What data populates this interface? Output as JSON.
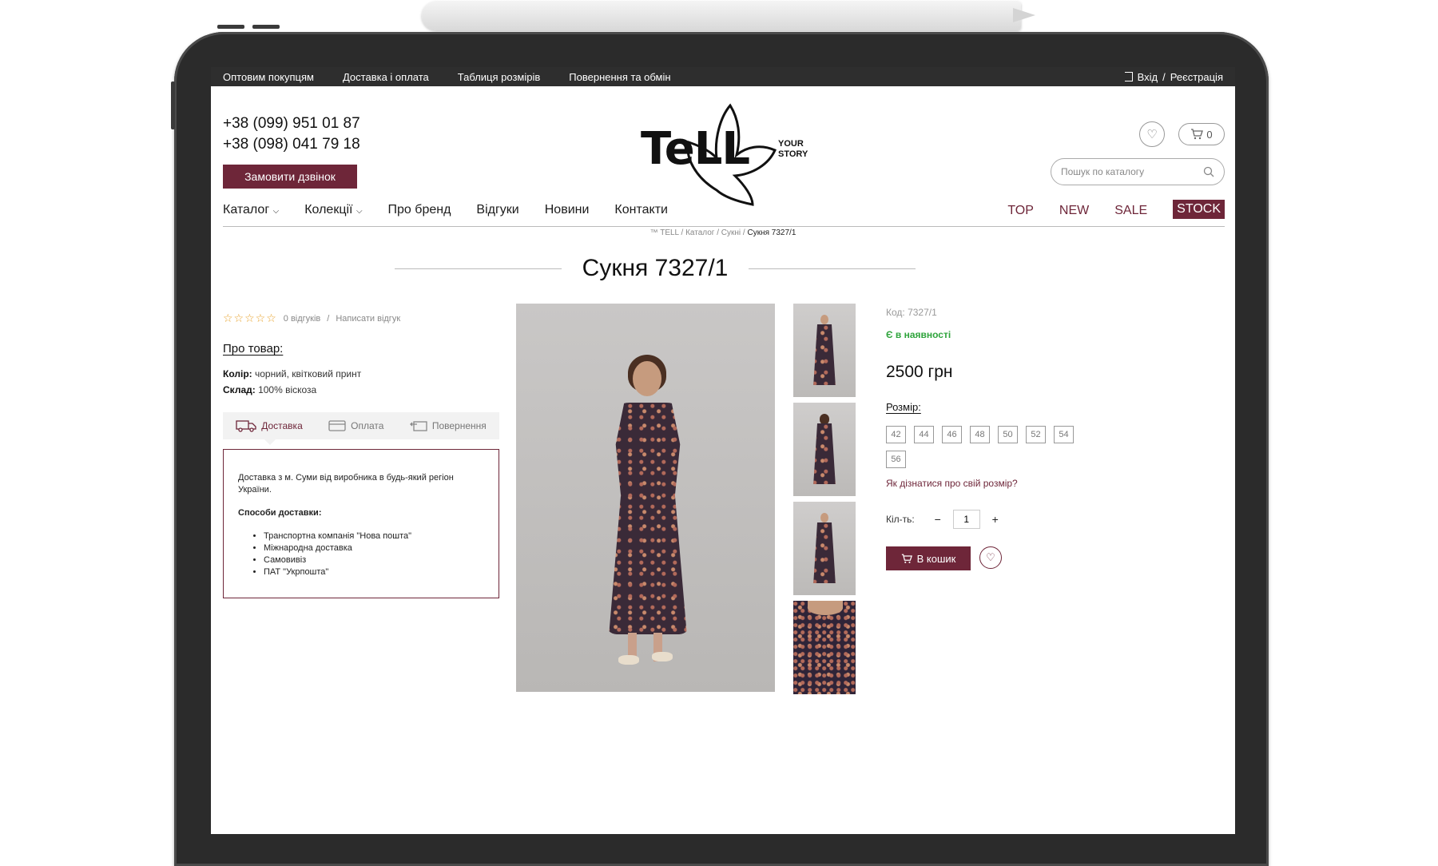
{
  "topbar": {
    "links": [
      "Оптовим покупцям",
      "Доставка і оплата",
      "Таблиця розмірів",
      "Повернення та обмін"
    ],
    "login": "Вхід",
    "separator": "/",
    "register": "Реєстрація"
  },
  "header": {
    "phones": [
      "+38 (099) 951 01 87",
      "+38 (098) 041 79 18"
    ],
    "callback_label": "Замовити дзвінок",
    "logo_text": "TeLL",
    "logo_tagline_1": "YOUR",
    "logo_tagline_2": "STORY",
    "cart_count": "0",
    "search_placeholder": "Пошук по каталогу"
  },
  "nav": {
    "catalog": "Каталог",
    "collections": "Колекції",
    "about": "Про бренд",
    "reviews": "Відгуки",
    "news": "Новини",
    "contacts": "Контакти",
    "tags": [
      "TOP",
      "NEW",
      "SALE"
    ],
    "stock": "STOCK"
  },
  "breadcrumb": {
    "items": [
      "™ TELL",
      "Каталог",
      "Сукні"
    ],
    "separator": "/",
    "current": "Сукня 7327/1"
  },
  "product": {
    "title": "Сукня 7327/1",
    "reviews_count": "0 відгуків",
    "reviews_separator": "/",
    "write_review": "Написати відгук",
    "about_title": "Про товар:",
    "color_label": "Колір:",
    "color_value": " чорний, квітковий принт",
    "composition_label": "Склад:",
    "composition_value": " 100% віскоза",
    "sku": "Код: 7327/1",
    "availability": "Є в наявності",
    "price": "2500 грн",
    "size_title": "Розмір:",
    "sizes": [
      "42",
      "44",
      "46",
      "48",
      "50",
      "52",
      "54",
      "56"
    ],
    "size_help": "Як дізнатися про свій розмір?",
    "qty_label": "Кіл-ть:",
    "qty_minus": "−",
    "qty_value": "1",
    "qty_plus": "+",
    "add_to_cart": "В кошик"
  },
  "info_tabs": {
    "tabs": [
      "Доставка",
      "Оплата",
      "Повернення"
    ],
    "active": 0,
    "delivery_text": "Доставка з м. Суми від виробника в будь-який регіон України.",
    "ways_title": "Способи доставки:",
    "ways": [
      "Транспортна компанія \"Нова пошта\"",
      "Міжнародна доставка",
      "Самовивіз",
      "ПАТ \"Укрпошта\""
    ]
  },
  "colors": {
    "accent": "#6e2639",
    "in_stock": "#2fa43c",
    "stars": "#e8a32c"
  },
  "icons": {
    "wishlist": "heart-icon",
    "cart": "cart-icon",
    "search": "search-icon",
    "login": "login-icon",
    "delivery": "truck-icon",
    "payment": "card-icon",
    "return": "return-icon"
  }
}
